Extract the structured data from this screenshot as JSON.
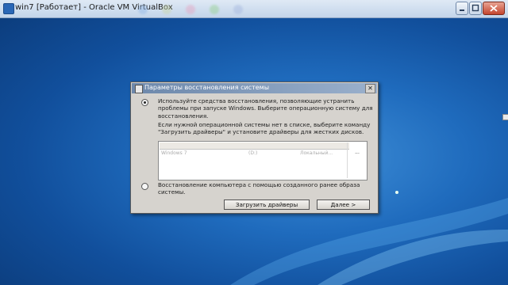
{
  "window": {
    "title": "win7 [Работает] - Oracle VM VirtualBox"
  },
  "dialog": {
    "title": "Параметры восстановления системы",
    "close_glyph": "✕",
    "option1": {
      "selected": true,
      "text": "Используйте средства восстановления, позволяющие устранить проблемы при запуске Windows. Выберите операционную систему для восстановления."
    },
    "info_text": "Если нужной операционной системы нет в списке, выберите команду \"Загрузить драйверы\" и установите драйверы для жестких дисков.",
    "os_list": {
      "rows": [
        {
          "name": "Windows 7",
          "drive": "(D:)",
          "location": "Локальный..."
        }
      ],
      "browse_label": "..."
    },
    "option2": {
      "selected": false,
      "text": "Восстановление компьютера с помощью созданного ранее образа системы."
    },
    "buttons": {
      "load_drivers": "Загрузить драйверы",
      "next": "Далее >"
    }
  },
  "colors": {
    "desktop": "#1f6bbd",
    "dialog_title_bar": "#6d88ab",
    "dialog_bg": "#d6d3ce"
  }
}
